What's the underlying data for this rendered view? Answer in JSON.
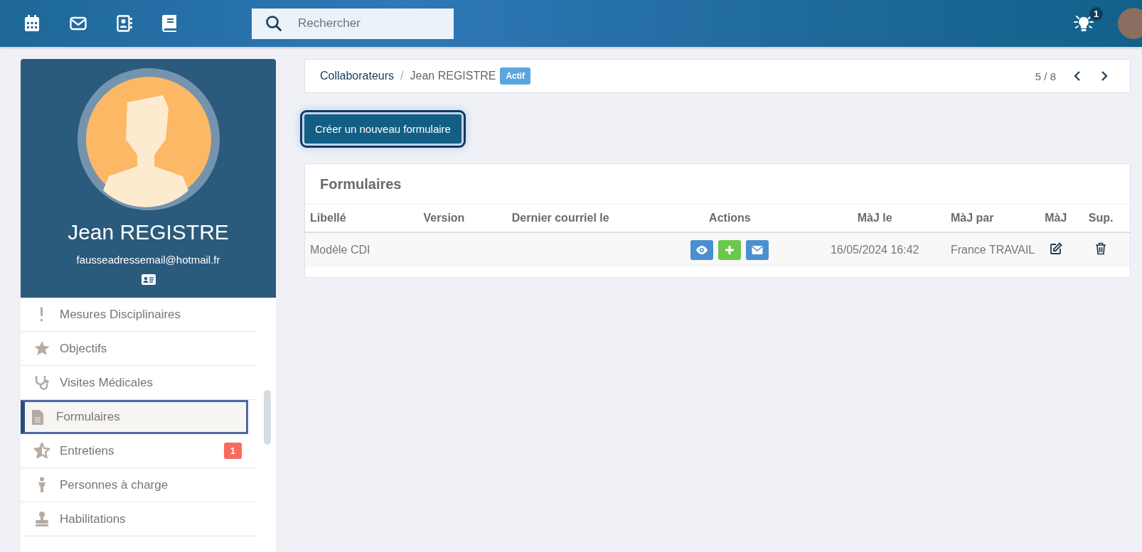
{
  "header": {
    "search": {
      "placeholder": "Rechercher"
    },
    "notifications": {
      "count": "1"
    }
  },
  "profile": {
    "name": "Jean REGISTRE",
    "email": "fausseadressemail@hotmail.fr"
  },
  "sidebar": {
    "items": [
      {
        "kind": "exclamation",
        "label": "Mesures Disciplinaires",
        "selected": false
      },
      {
        "kind": "star",
        "label": "Objectifs",
        "selected": false
      },
      {
        "kind": "stethoscope",
        "label": "Visites Médicales",
        "selected": false
      },
      {
        "kind": "document",
        "label": "Formulaires",
        "selected": true
      },
      {
        "kind": "star-half",
        "label": "Entretiens",
        "selected": false,
        "badge": "1"
      },
      {
        "kind": "person",
        "label": "Personnes à charge",
        "selected": false
      },
      {
        "kind": "stamp",
        "label": "Habilitations",
        "selected": false
      }
    ]
  },
  "breadcrumb": {
    "items": [
      "Collaborateurs",
      "Jean REGISTRE"
    ],
    "separator": "/",
    "status": "Actif",
    "pager": "5 / 8"
  },
  "create_button": "Créer un nouveau formulaire",
  "forms": {
    "title": "Formulaires",
    "columns": [
      "Libellé",
      "Version",
      "Dernier courriel le",
      "Actions",
      "MàJ le",
      "MàJ par",
      "MàJ",
      "Sup."
    ],
    "rows": [
      {
        "label": "Modèle CDI",
        "version": "",
        "last_email": "",
        "actions": [
          {
            "kind": "view"
          },
          {
            "kind": "add"
          },
          {
            "kind": "mail"
          }
        ],
        "updated": "16/05/2024 16:42",
        "updated_by": "France TRAVAIL"
      }
    ]
  }
}
